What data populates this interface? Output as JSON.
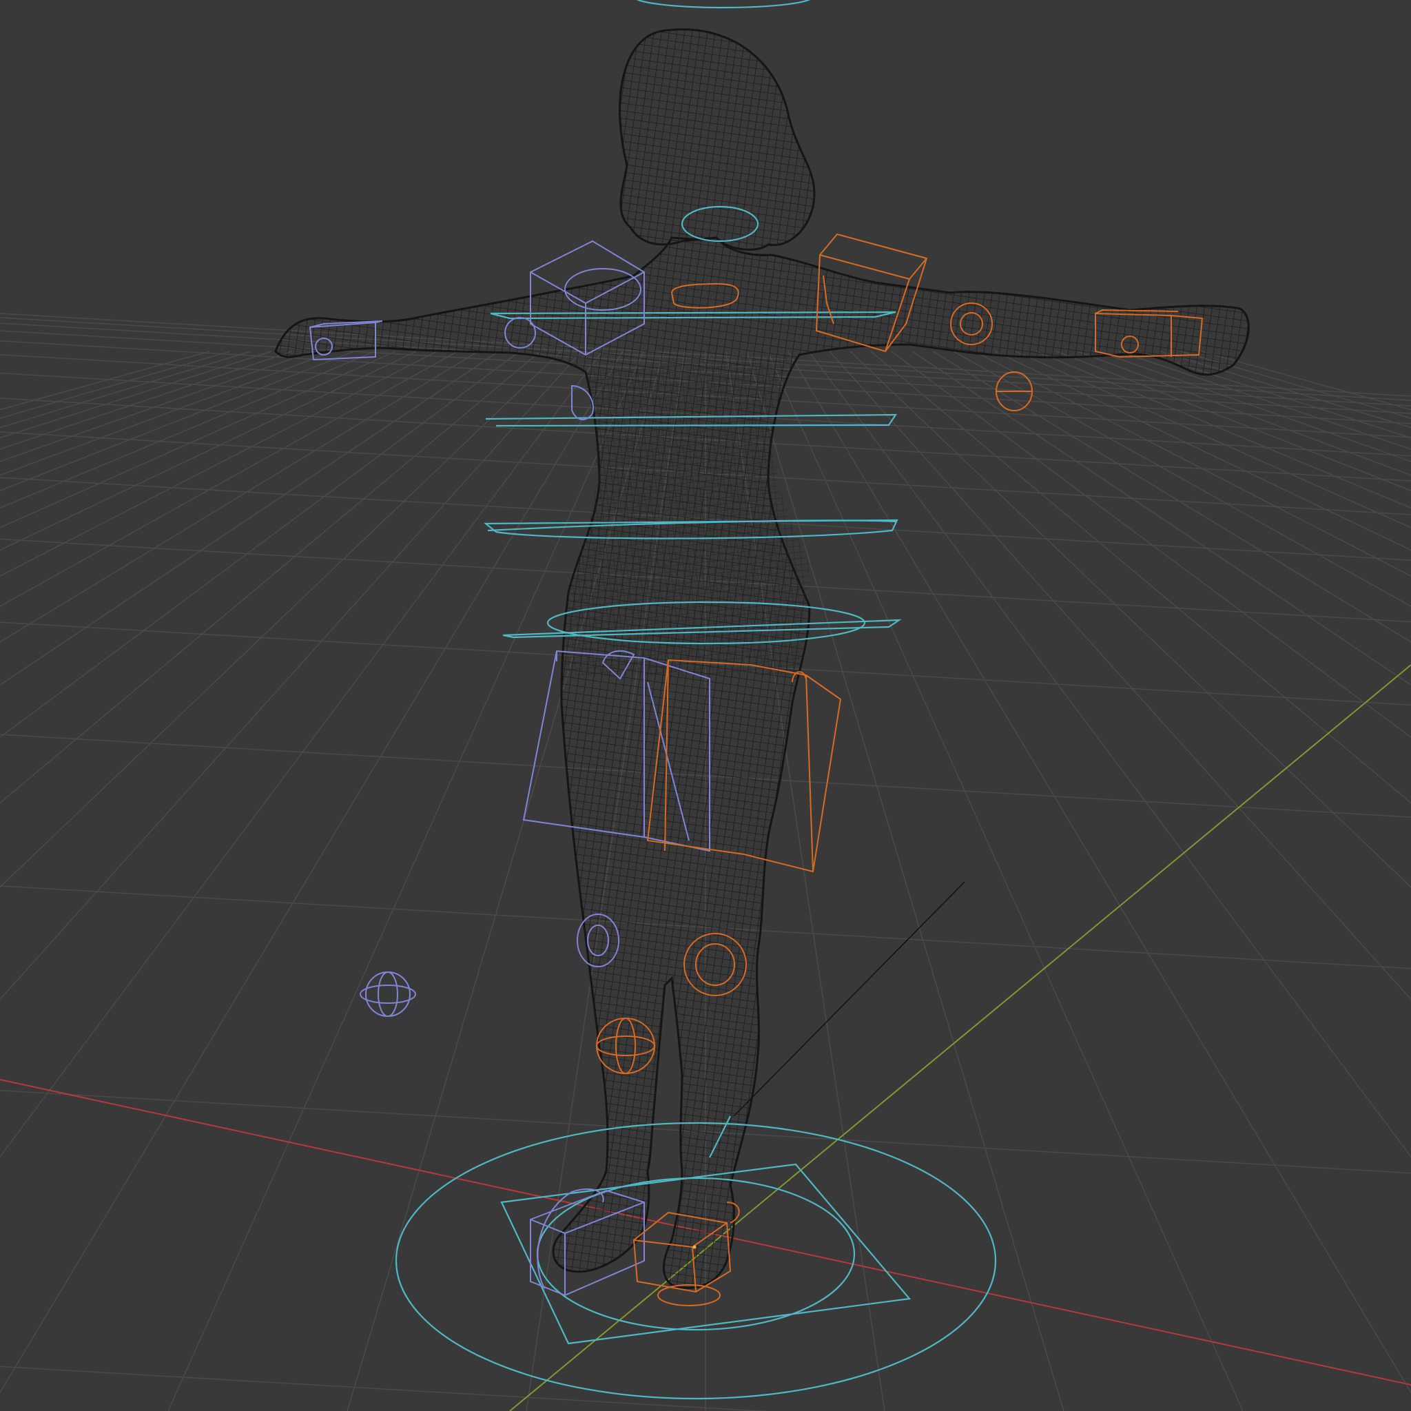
{
  "viewport": {
    "background": "#393939",
    "grid_color": "#4a4a4a",
    "axis_x_color": "#b53a3a",
    "axis_y_color": "#7f9a2e",
    "mesh_color": "#1a1a1a",
    "control_cyan": "#4fb8c4",
    "control_blue": "#7f86d8",
    "control_orange": "#d86a22"
  },
  "scene": {
    "model": "wireframe-humanoid-t-pose",
    "controls": [
      "head-control-ring",
      "neck-control-ring",
      "chest-control-ring",
      "spine-control-ring",
      "waist-control-ring",
      "hips-control-ring",
      "root-control-circle",
      "shoulder-left-box",
      "shoulder-right-box",
      "upper-leg-left-box",
      "upper-leg-right-box",
      "hand-left-box",
      "hand-right-box",
      "knee-left-target",
      "knee-right-target",
      "foot-left-box",
      "foot-right-box",
      "elbow-pole-left",
      "knee-pole-right"
    ]
  }
}
